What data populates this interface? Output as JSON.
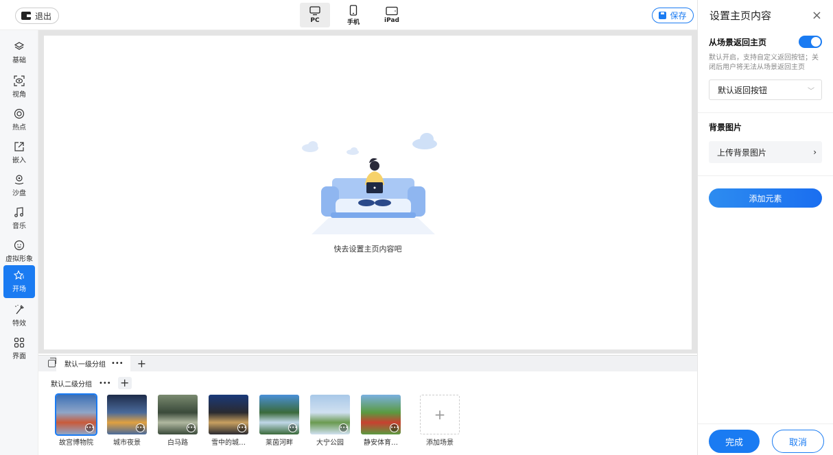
{
  "topbar": {
    "exit_label": "退出",
    "save_label": "保存",
    "devices": [
      {
        "label": "PC",
        "icon": "monitor-icon",
        "active": true
      },
      {
        "label": "手机",
        "icon": "phone-icon",
        "active": false
      },
      {
        "label": "iPad",
        "icon": "tablet-icon",
        "active": false
      }
    ]
  },
  "sidebar": {
    "items": [
      {
        "label": "基础",
        "icon": "layers-icon"
      },
      {
        "label": "视角",
        "icon": "view-icon"
      },
      {
        "label": "热点",
        "icon": "hotspot-icon"
      },
      {
        "label": "嵌入",
        "icon": "embed-icon"
      },
      {
        "label": "沙盘",
        "icon": "sandbox-icon"
      },
      {
        "label": "音乐",
        "icon": "music-icon"
      },
      {
        "label": "虚拟形象",
        "icon": "avatar-icon"
      },
      {
        "label": "开场",
        "icon": "star-icon",
        "active": true
      },
      {
        "label": "特效",
        "icon": "magic-wand-icon"
      },
      {
        "label": "界面",
        "icon": "grid-icon"
      }
    ]
  },
  "canvas": {
    "empty_text": "快去设置主页内容吧"
  },
  "groups": {
    "level1_label": "默认一级分组",
    "level2_label": "默认二级分组",
    "more": "•••",
    "plus": "+"
  },
  "scenes": {
    "items": [
      {
        "name": "故宫博物院",
        "colors": [
          "#3b6fb5",
          "#c85a3a",
          "#8fa6c8"
        ]
      },
      {
        "name": "城市夜景",
        "colors": [
          "#1e2c4a",
          "#e0a040",
          "#4a6a9a"
        ]
      },
      {
        "name": "白马路",
        "colors": [
          "#7a8a70",
          "#b0b8a0",
          "#3a4a3a"
        ]
      },
      {
        "name": "雪中的城…",
        "colors": [
          "#1a3a7a",
          "#c8a060",
          "#2a2a30"
        ]
      },
      {
        "name": "莱茵河畔",
        "colors": [
          "#4a90d8",
          "#c0d8e8",
          "#3a6a3a"
        ]
      },
      {
        "name": "大宁公园",
        "colors": [
          "#a8c8e8",
          "#6a9a50",
          "#d0e0f0"
        ]
      },
      {
        "name": "静安体育…",
        "colors": [
          "#7ab0e0",
          "#c84030",
          "#5a9a40"
        ]
      }
    ],
    "add_label": "添加场景"
  },
  "rpanel": {
    "title": "设置主页内容",
    "close": "×",
    "return_title": "从场景返回主页",
    "return_desc": "默认开启，支持自定义返回按钮；关闭后用户将无法从场景返回主页",
    "return_select": "默认返回按钮",
    "bg_title": "背景图片",
    "upload_label": "上传背景图片",
    "add_elem_label": "添加元素",
    "done_label": "完成",
    "cancel_label": "取消"
  }
}
